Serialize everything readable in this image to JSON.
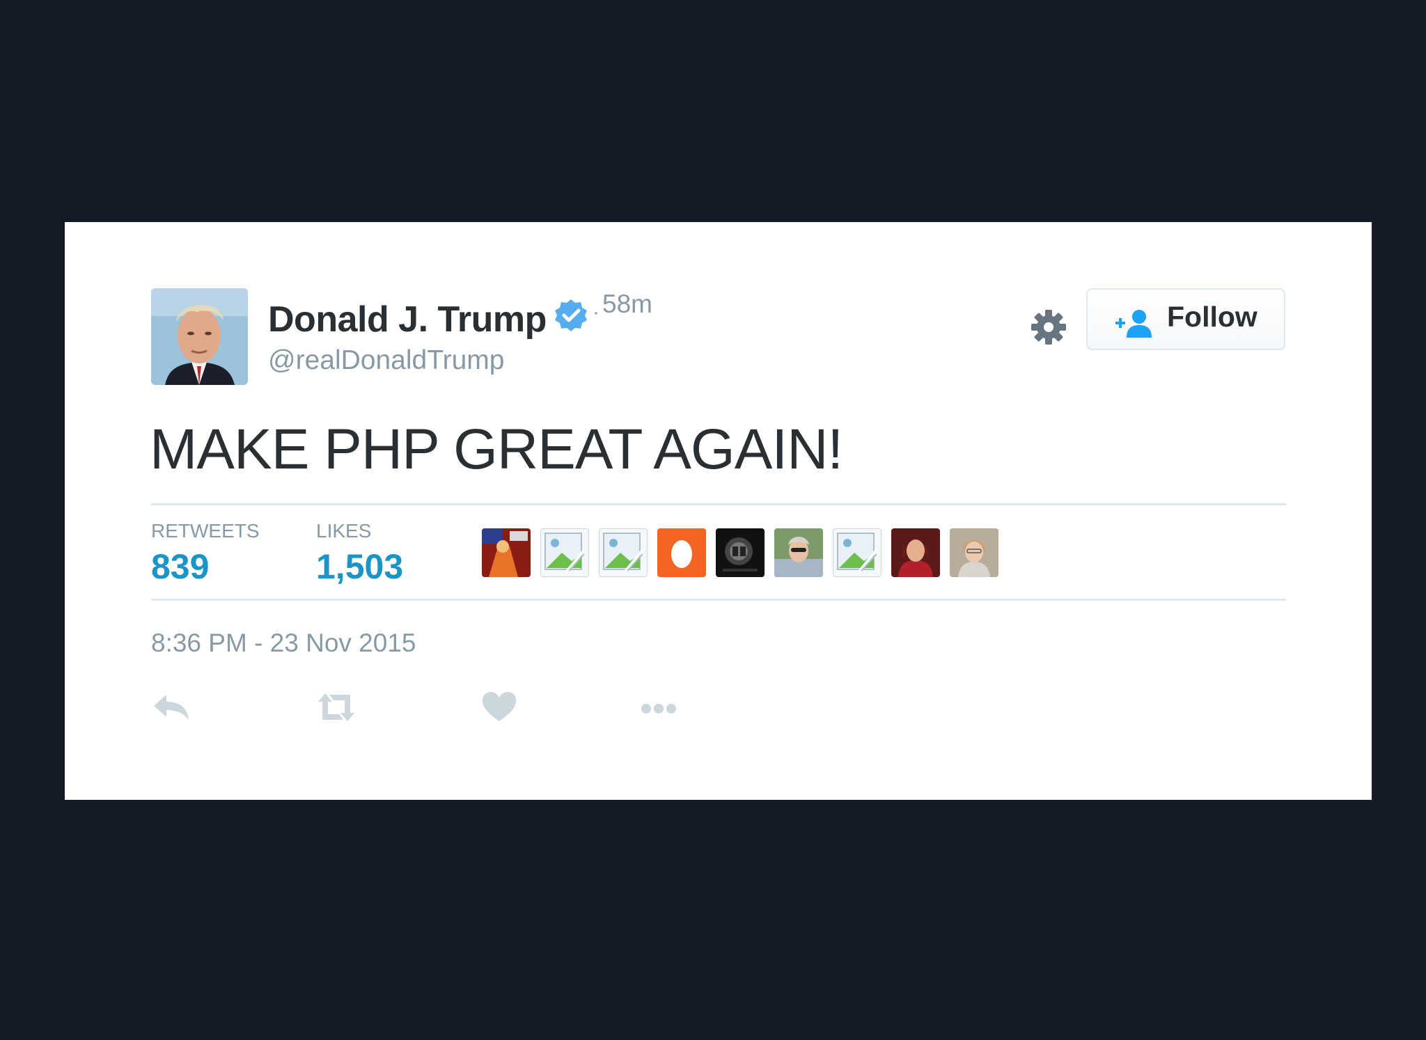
{
  "tweet": {
    "author": {
      "display_name": "Donald J. Trump",
      "handle": "@realDonaldTrump",
      "verified": true,
      "avatar_icon": "profile-photo"
    },
    "relative_time": "58m",
    "separator": "·",
    "text": "MAKE PHP GREAT AGAIN!",
    "follow_button": {
      "label": "Follow",
      "icon": "follow-person-plus-icon"
    },
    "settings_icon": "gear-icon",
    "stats": {
      "retweets_label": "RETWEETS",
      "retweets_count": "839",
      "likes_label": "LIKES",
      "likes_count": "1,503"
    },
    "likers": [
      {
        "kind": "photo",
        "icon": "liker-avatar-1"
      },
      {
        "kind": "broken-image",
        "icon": "broken-image-icon"
      },
      {
        "kind": "broken-image",
        "icon": "broken-image-icon"
      },
      {
        "kind": "egg",
        "icon": "egg-avatar-icon"
      },
      {
        "kind": "photo",
        "icon": "liker-avatar-dark"
      },
      {
        "kind": "photo",
        "icon": "liker-avatar-person"
      },
      {
        "kind": "broken-image",
        "icon": "broken-image-icon"
      },
      {
        "kind": "photo",
        "icon": "liker-avatar-person"
      },
      {
        "kind": "photo",
        "icon": "liker-avatar-person"
      }
    ],
    "full_timestamp": "8:36 PM - 23 Nov 2015",
    "actions": [
      "reply-icon",
      "retweet-icon",
      "like-heart-icon",
      "more-dots-icon"
    ]
  },
  "colors": {
    "background": "#141b27",
    "card": "#ffffff",
    "text_primary": "#292f33",
    "text_secondary": "#8899a6",
    "stat_value": "#1b95c7",
    "verified_badge": "#55acee",
    "follow_icon": "#1da1f2",
    "divider": "#e1e8ed",
    "egg_orange": "#f26522"
  }
}
